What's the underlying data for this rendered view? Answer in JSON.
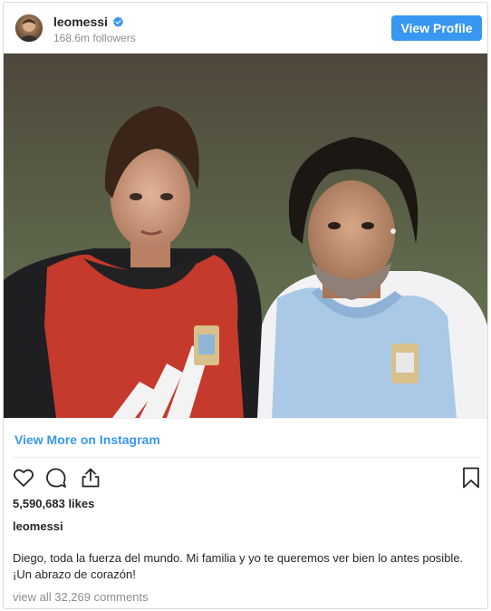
{
  "header": {
    "username": "leomessi",
    "followers": "168.6m followers",
    "view_profile_label": "View Profile"
  },
  "photo": {
    "description_icon": "photo"
  },
  "view_more_label": "View More on Instagram",
  "actions": {
    "icons": [
      "heart-icon",
      "comment-icon",
      "share-icon",
      "bookmark-icon"
    ]
  },
  "likes": "5,590,683 likes",
  "caption": {
    "username": "leomessi",
    "text": "Diego, toda la fuerza del mundo. Mi familia y yo te queremos ver bien lo antes posible. ¡Un abrazo de corazón!"
  },
  "view_comments_label": "view all 32,269 comments",
  "colors": {
    "accent": "#3897f0",
    "text": "#262626",
    "muted": "#8e8e8e",
    "border": "#dbdbdb"
  }
}
